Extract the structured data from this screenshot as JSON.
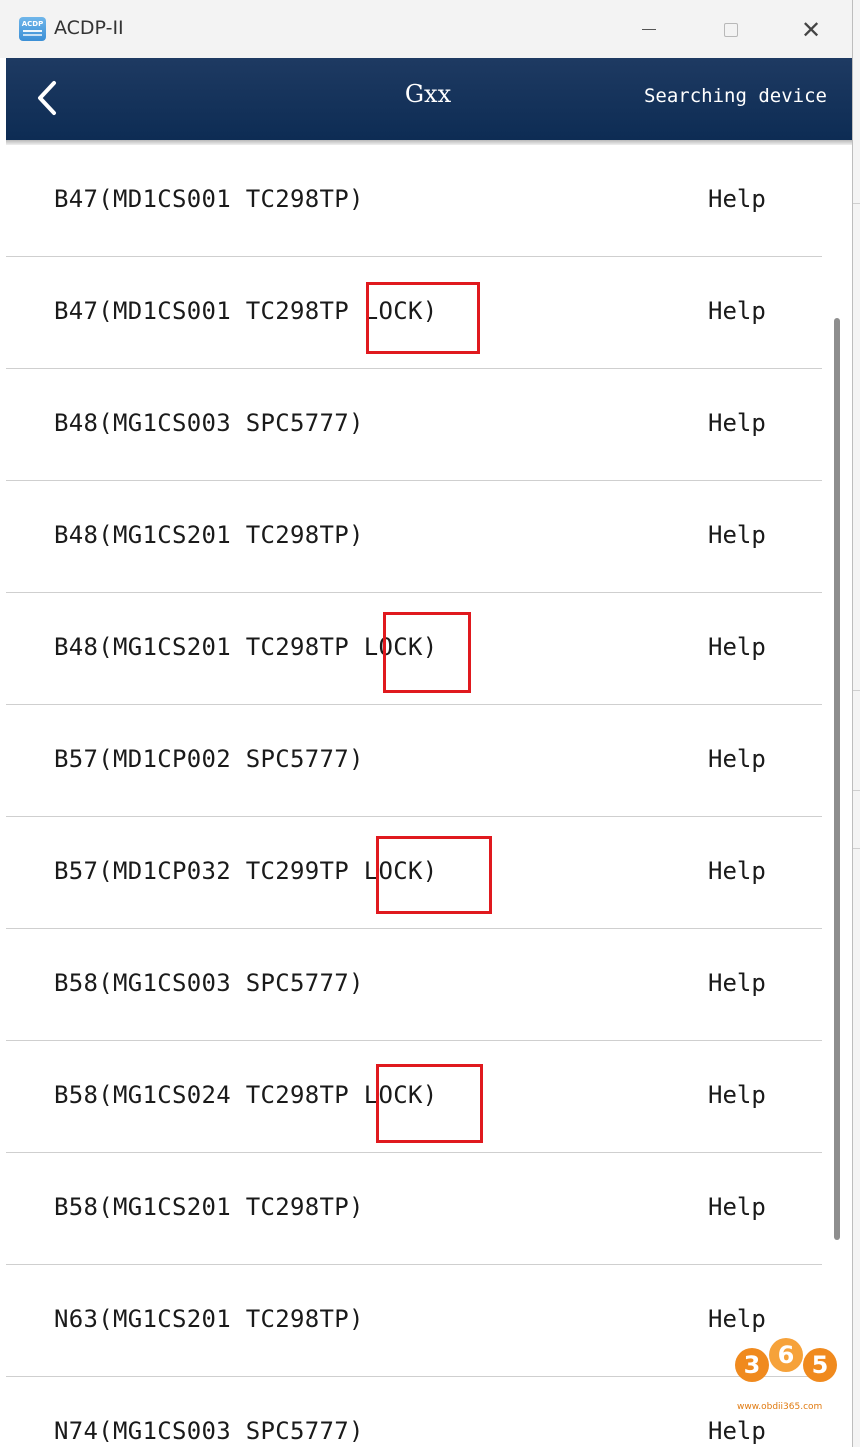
{
  "window": {
    "title": "ACDP-II",
    "icon_text": "ACDP"
  },
  "appbar": {
    "title": "Gxx",
    "status": "Searching device"
  },
  "list": {
    "help_label": "Help",
    "items": [
      {
        "label": "B47(MD1CS001 TC298TP)",
        "locked": false
      },
      {
        "label": "B47(MD1CS001 TC298TP LOCK)",
        "locked": true
      },
      {
        "label": "B48(MG1CS003 SPC5777)",
        "locked": false
      },
      {
        "label": "B48(MG1CS201 TC298TP)",
        "locked": false
      },
      {
        "label": "B48(MG1CS201 TC298TP LOCK)",
        "locked": true
      },
      {
        "label": "B57(MD1CP002 SPC5777)",
        "locked": false
      },
      {
        "label": "B57(MD1CP032 TC299TP LOCK)",
        "locked": true
      },
      {
        "label": "B58(MG1CS003 SPC5777)",
        "locked": false
      },
      {
        "label": "B58(MG1CS024 TC298TP LOCK)",
        "locked": true
      },
      {
        "label": "B58(MG1CS201 TC298TP)",
        "locked": false
      },
      {
        "label": "N63(MG1CS201 TC298TP)",
        "locked": false
      },
      {
        "label": "N74(MG1CS003 SPC5777)",
        "locked": false
      }
    ]
  },
  "watermark": {
    "digits": [
      "3",
      "6",
      "5"
    ],
    "url": "www.obdii365.com"
  },
  "colors": {
    "appbar": "#0d2c54",
    "highlight": "#e0191e",
    "watermark": "#f08a1e"
  }
}
